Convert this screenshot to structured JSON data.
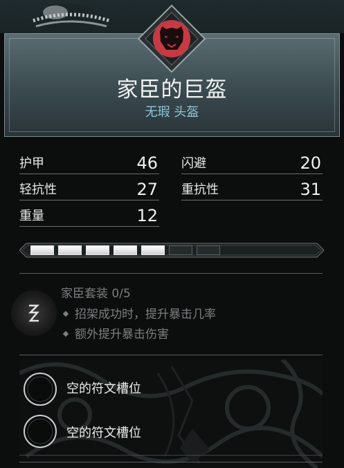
{
  "item": {
    "name": "家臣的巨盔",
    "subtitle": "无瑕 头盔"
  },
  "stats": [
    {
      "label": "护甲",
      "value": "46"
    },
    {
      "label": "闪避",
      "value": "20"
    },
    {
      "label": "轻抗性",
      "value": "27"
    },
    {
      "label": "重抗性",
      "value": "31"
    },
    {
      "label": "重量",
      "value": "12"
    }
  ],
  "quality": {
    "filled": 5,
    "total": 7
  },
  "set": {
    "title": "家臣套装 0/5",
    "icon": "rune-z-icon",
    "bonuses": [
      "招架成功时，提升暴击几率",
      "额外提升暴击伤害"
    ]
  },
  "rune_slots": [
    {
      "label": "空的符文槽位"
    },
    {
      "label": "空的符文槽位"
    }
  ],
  "colors": {
    "emblem_red": "#c83a43",
    "subtitle_blue": "#8fc7da",
    "set_gray": "#7c7f80"
  },
  "icons": {
    "emblem": "bear-emblem-icon",
    "helmet": "helmet-icon"
  }
}
